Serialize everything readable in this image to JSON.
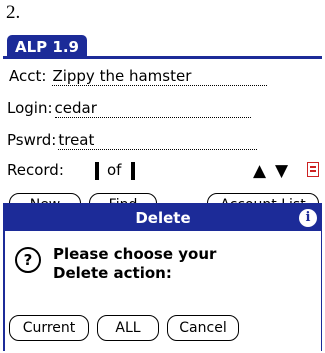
{
  "step_label": "2.",
  "app": {
    "title": "ALP 1.9"
  },
  "fields": {
    "acct": {
      "label": "Acct:",
      "value": "Zippy the hamster"
    },
    "login": {
      "label": "Login:",
      "value": "cedar"
    },
    "pswd": {
      "label": "Pswrd:",
      "value": "treat"
    }
  },
  "record": {
    "label": "Record:",
    "of": "of"
  },
  "buttons_behind": [
    "New",
    "Find",
    "Account List"
  ],
  "dialog": {
    "title": "Delete",
    "message_line1": "Please choose your",
    "message_line2": "Delete action:",
    "buttons": {
      "current": "Current",
      "all": "ALL",
      "cancel": "Cancel"
    }
  },
  "colors": {
    "title_bar": "#1c2b98",
    "doc_icon": "#cc2222"
  },
  "icons": [
    "up-arrow-icon",
    "down-arrow-icon",
    "document-icon",
    "info-icon",
    "question-icon"
  ]
}
